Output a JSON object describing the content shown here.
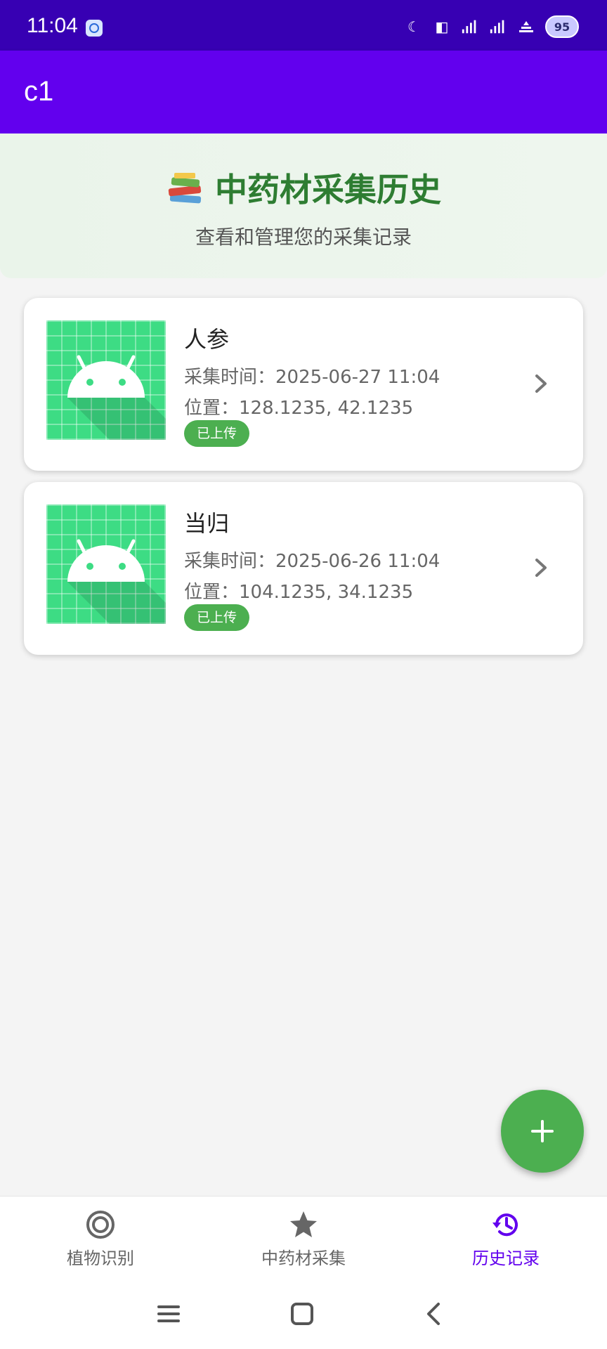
{
  "status_bar": {
    "time": "11:04",
    "battery": "95"
  },
  "app_bar": {
    "title": "c1"
  },
  "header": {
    "title": "中药材采集历史",
    "subtitle": "查看和管理您的采集记录"
  },
  "records": [
    {
      "name": "人参",
      "time": "采集时间：2025-06-27 11:04",
      "location": "位置：128.1235, 42.1235",
      "status": "已上传"
    },
    {
      "name": "当归",
      "time": "采集时间：2025-06-26 11:04",
      "location": "位置：104.1235, 34.1235",
      "status": "已上传"
    }
  ],
  "fab": {
    "icon": "add-icon"
  },
  "bottom_nav": {
    "items": [
      {
        "label": "植物识别",
        "icon": "target-icon",
        "active": false
      },
      {
        "label": "中药材采集",
        "icon": "star-icon",
        "active": false
      },
      {
        "label": "历史记录",
        "icon": "history-icon",
        "active": true
      }
    ]
  },
  "colors": {
    "primary": "#6200ee",
    "primary_dark": "#3700b3",
    "accent_green": "#4caf50",
    "header_green": "#2e7d32"
  }
}
